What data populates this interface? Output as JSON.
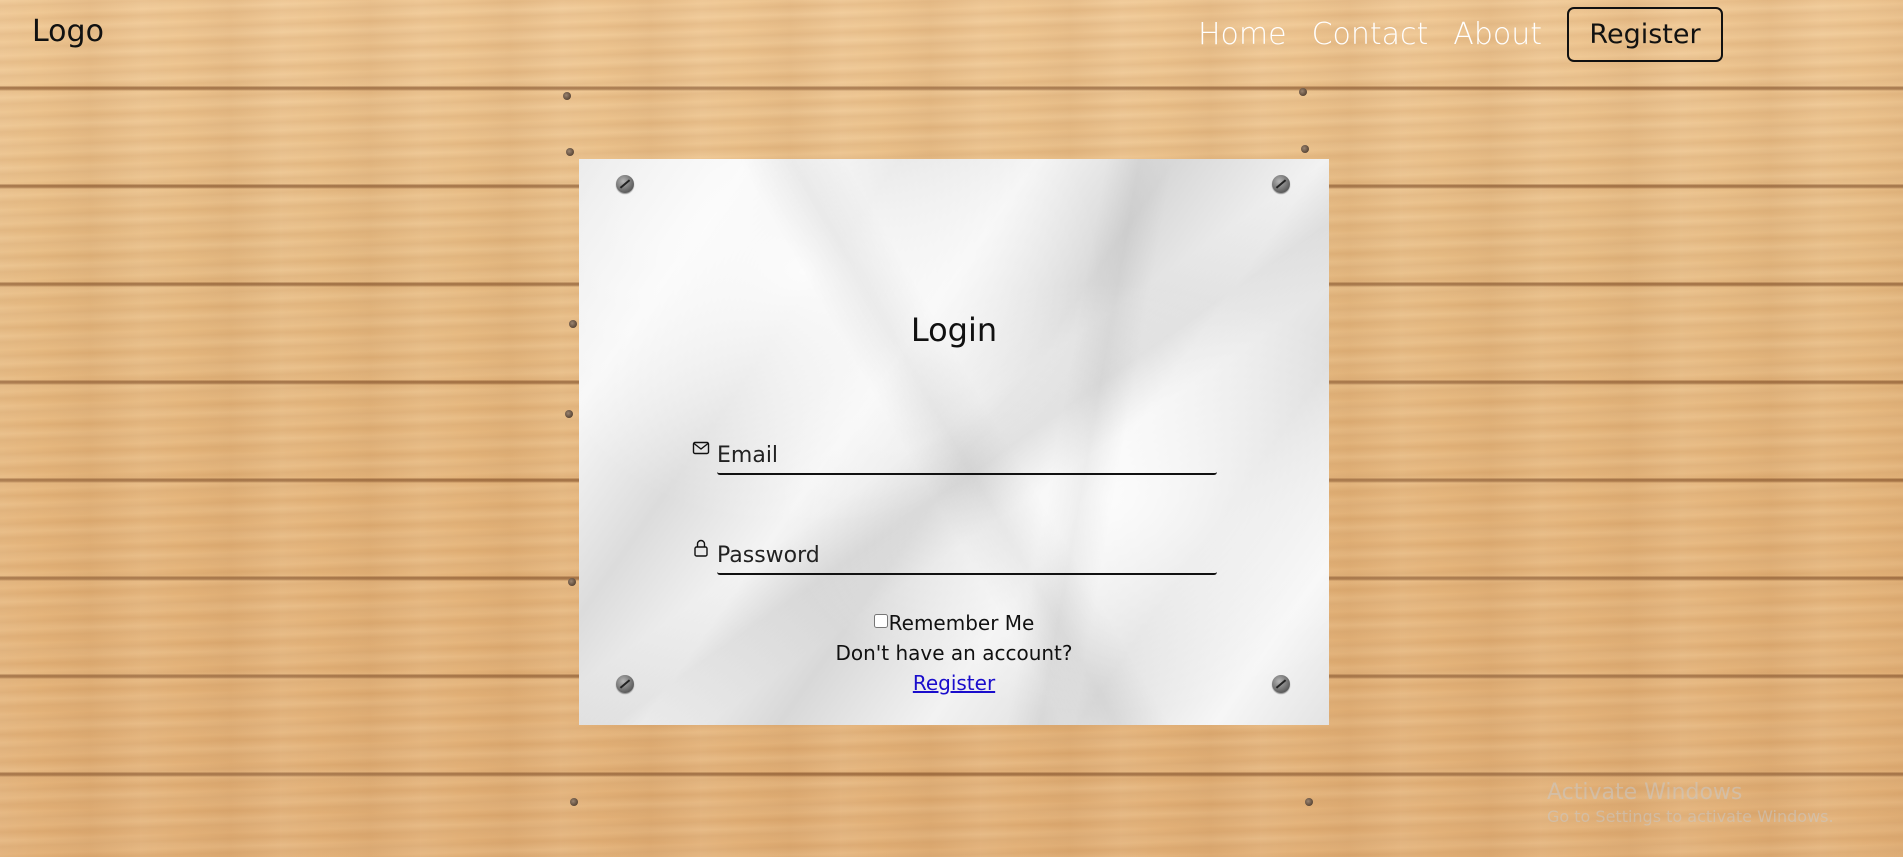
{
  "header": {
    "logo": "Logo",
    "nav": {
      "home": "Home",
      "contact": "Contact",
      "about": "About",
      "register_button": "Register"
    }
  },
  "login": {
    "title": "Login",
    "email_placeholder": "Email",
    "password_placeholder": "Password",
    "remember_label": "Remember Me",
    "no_account_text": "Don't have an account?",
    "register_link": "Register"
  },
  "watermark": {
    "title": "Activate Windows",
    "subtitle": "Go to Settings to activate Windows."
  },
  "icons": {
    "email": "mail-icon",
    "password": "lock-icon"
  },
  "colors": {
    "link": "#1a0dcc",
    "text": "#111111",
    "nav_text": "#ffffff"
  }
}
